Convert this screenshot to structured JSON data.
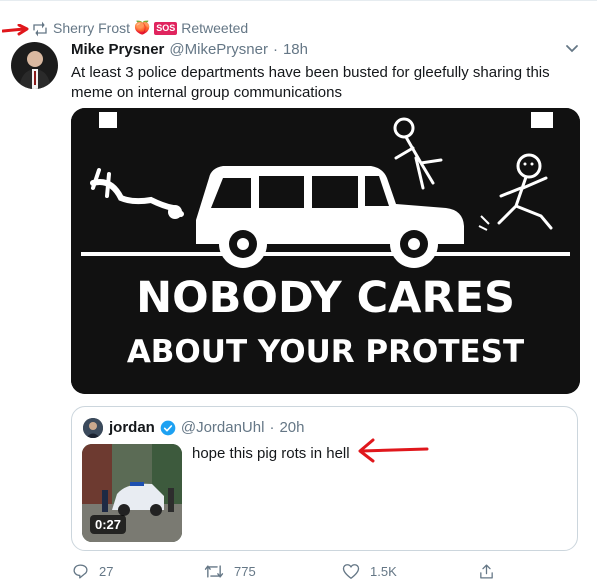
{
  "retweet": {
    "user": "Sherry Frost",
    "emoji": "🍑",
    "badge": "SOS",
    "label": "Retweeted"
  },
  "tweet": {
    "name": "Mike Prysner",
    "handle": "@MikePrysner",
    "dot": "·",
    "time": "18h",
    "text": "At least 3 police departments have been busted for gleefully sharing this meme on internal group communications"
  },
  "meme": {
    "line1": "NOBODY CARES",
    "line2": "ABOUT YOUR PROTEST"
  },
  "quote": {
    "name": "jordan",
    "handle": "@JordanUhl",
    "dot": "·",
    "time": "20h",
    "text": "hope this pig rots in hell",
    "duration": "0:27"
  },
  "actions": {
    "replies": "27",
    "retweets": "775",
    "likes": "1.5K"
  },
  "colors": {
    "annotation_red": "#e0171c",
    "muted": "#657786",
    "border": "#ccd6dd",
    "verified": "#1da1f2"
  }
}
